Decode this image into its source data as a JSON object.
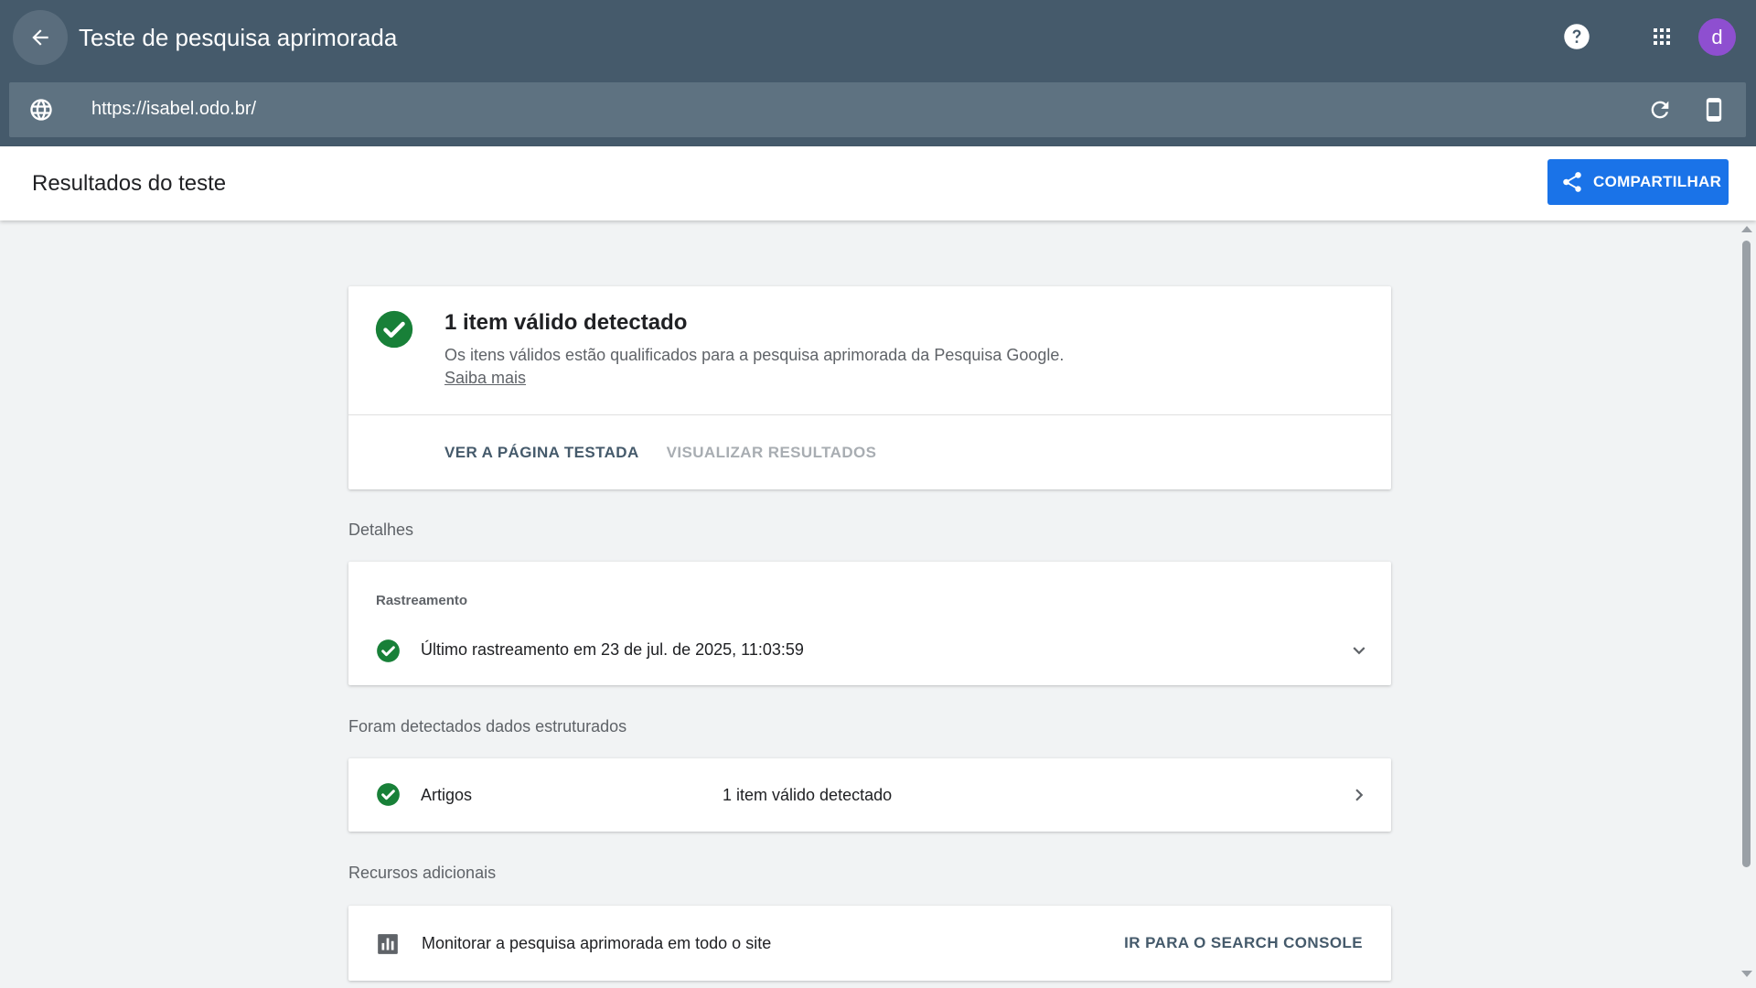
{
  "app": {
    "title": "Teste de pesquisa aprimorada",
    "avatar_letter": "d"
  },
  "icons": {
    "back": "arrow-back-icon",
    "help": "help-icon",
    "apps": "apps-grid-icon",
    "globe": "globe-icon",
    "refresh": "refresh-icon",
    "device": "smartphone-icon",
    "share": "share-icon",
    "check": "check-circle-icon",
    "expand": "chevron-down-icon",
    "open": "chevron-right-icon",
    "chart": "bar-chart-icon"
  },
  "colors": {
    "header_bg": "#455a6b",
    "url_bg": "#5e7281",
    "accent": "#1a73e8",
    "success": "#188038",
    "avatar_bg": "#8e4fd0"
  },
  "url_bar": {
    "url": "https://isabel.odo.br/"
  },
  "results": {
    "title": "Resultados do teste",
    "share_label": "COMPARTILHAR"
  },
  "summary": {
    "title": "1 item válido detectado",
    "description": "Os itens válidos estão qualificados para a pesquisa aprimorada da Pesquisa Google.",
    "learn_more": "Saiba mais",
    "view_tested_page": "VER A PÁGINA TESTADA",
    "preview_results": "VISUALIZAR RESULTADOS"
  },
  "details": {
    "section_label": "Detalhes",
    "crawl_label": "Rastreamento",
    "crawl_text": "Último rastreamento em 23 de jul. de 2025, 11:03:59"
  },
  "structured": {
    "section_label": "Foram detectados dados estruturados",
    "items": [
      {
        "name": "Artigos",
        "status": "1 item válido detectado"
      }
    ]
  },
  "resources": {
    "section_label": "Recursos adicionais",
    "monitor_text": "Monitorar a pesquisa aprimorada em todo o site",
    "console_link": "IR PARA O SEARCH CONSOLE"
  }
}
